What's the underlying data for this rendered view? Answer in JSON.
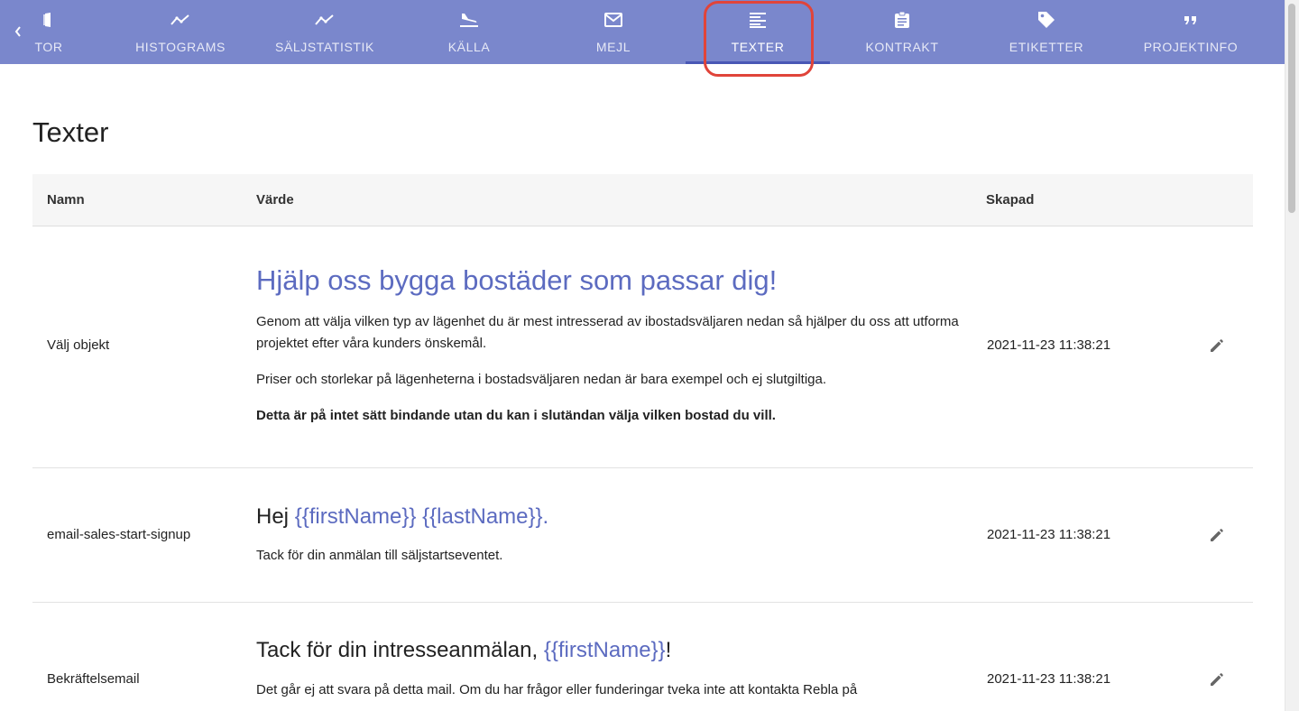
{
  "nav": {
    "tabs": [
      {
        "label": "TOR",
        "icon": "door-icon"
      },
      {
        "label": "HISTOGRAMS",
        "icon": "trend-line-icon"
      },
      {
        "label": "SÄLJSTATISTIK",
        "icon": "trend-line-icon"
      },
      {
        "label": "KÄLLA",
        "icon": "flight-land-icon"
      },
      {
        "label": "MEJL",
        "icon": "mail-icon"
      },
      {
        "label": "TEXTER",
        "icon": "text-lines-icon"
      },
      {
        "label": "KONTRAKT",
        "icon": "clipboard-icon"
      },
      {
        "label": "ETIKETTER",
        "icon": "tag-icon"
      },
      {
        "label": "PROJEKTINFO",
        "icon": "quote-icon"
      }
    ],
    "active_tab": "TEXTER",
    "highlight_color": "#e0443a",
    "bar_color": "#7a87cc"
  },
  "page": {
    "title": "Texter"
  },
  "table": {
    "headers": {
      "name": "Namn",
      "value": "Värde",
      "created": "Skapad"
    },
    "rows": [
      {
        "name": "Välj objekt",
        "heading": "Hjälp oss bygga bostäder som passar dig!",
        "p1": "Genom att välja vilken typ av lägenhet du är mest intresserad av ibostadsväljaren nedan så hjälper du oss att utforma projektet efter våra kunders önskemål.",
        "p2": "Priser och storlekar på lägenheterna i bostadsväljaren nedan är bara exempel och ej slutgiltiga.",
        "p3": "Detta är på intet sätt bindande utan du kan i slutändan välja vilken bostad du vill.",
        "created": "2021-11-23 11:38:21"
      },
      {
        "name": "email-sales-start-signup",
        "heading_prefix": "Hej ",
        "var1": "{{firstName}}",
        "var2": "{{lastName}}",
        "heading_suffix": ".",
        "p1": "Tack för din anmälan till säljstartseventet.",
        "created": "2021-11-23 11:38:21"
      },
      {
        "name": "Bekräftelsemail",
        "heading_prefix": "Tack för din intresseanmälan, ",
        "var1": "{{firstName}}",
        "heading_suffix": "!",
        "p1": "Det går ej att svara på detta mail. Om du har frågor eller funderingar tveka inte att kontakta Rebla på",
        "created": "2021-11-23 11:38:21"
      }
    ]
  },
  "colors": {
    "accent": "#5c6bc0"
  }
}
